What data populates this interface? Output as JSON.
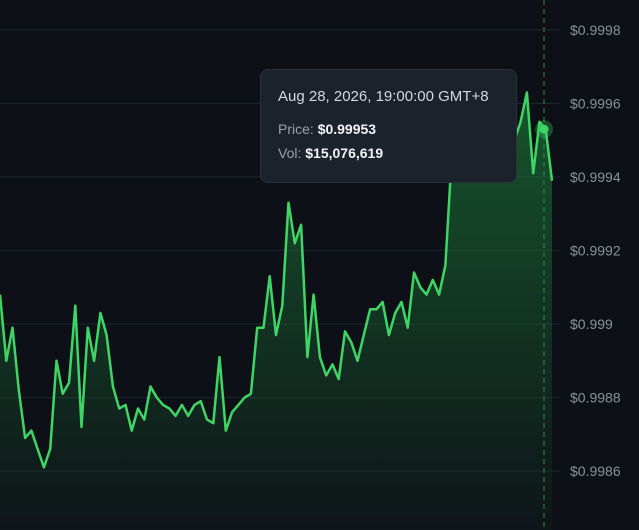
{
  "chart_data": {
    "type": "area",
    "y_axis_position": "right",
    "grid": true,
    "ylim": [
      0.99845,
      0.99982
    ],
    "yticks": [
      {
        "value": 0.9998,
        "label": "$0.9998"
      },
      {
        "value": 0.9996,
        "label": "$0.9996"
      },
      {
        "value": 0.9994,
        "label": "$0.9994"
      },
      {
        "value": 0.9992,
        "label": "$0.9992"
      },
      {
        "value": 0.999,
        "label": "$0.999"
      },
      {
        "value": 0.9988,
        "label": "$0.9988"
      },
      {
        "value": 0.9986,
        "label": "$0.9986"
      }
    ],
    "series": [
      {
        "values": [
          0.99908,
          0.9989,
          0.99899,
          0.99882,
          0.99869,
          0.99871,
          0.99866,
          0.99861,
          0.99866,
          0.9989,
          0.99881,
          0.99884,
          0.99905,
          0.99872,
          0.99899,
          0.9989,
          0.99903,
          0.99897,
          0.99883,
          0.99877,
          0.99878,
          0.99871,
          0.99877,
          0.99874,
          0.99883,
          0.9988,
          0.99878,
          0.99877,
          0.99875,
          0.99878,
          0.99875,
          0.99878,
          0.99879,
          0.99874,
          0.99873,
          0.99891,
          0.99871,
          0.99876,
          0.99878,
          0.9988,
          0.99881,
          0.99899,
          0.99899,
          0.99913,
          0.99897,
          0.99905,
          0.99933,
          0.99922,
          0.99927,
          0.99891,
          0.99908,
          0.99891,
          0.99886,
          0.99889,
          0.99885,
          0.99898,
          0.99895,
          0.9989,
          0.99897,
          0.99904,
          0.99904,
          0.99906,
          0.99897,
          0.99903,
          0.99906,
          0.99899,
          0.99914,
          0.9991,
          0.99908,
          0.99912,
          0.99908,
          0.99916,
          0.99945,
          0.9995,
          0.99952,
          0.99955,
          0.99958,
          0.9996,
          0.99955,
          0.99962,
          0.99958,
          0.99955,
          0.9995,
          0.99955,
          0.99963,
          0.99941,
          0.99955,
          0.99953,
          0.99939
        ]
      }
    ],
    "hover": {
      "point_index": 87,
      "date": "Aug 28, 2026, 19:00:00 GMT+8",
      "price_label": "Price:",
      "price_value": "$0.99953",
      "vol_label": "Vol:",
      "vol_value": "$15,076,619"
    },
    "colors": {
      "line": "#3fd565",
      "fill": "#1f8c3f",
      "grid": "#1e242c",
      "crosshair": "#2f8a4a",
      "background": "#0d1117"
    }
  }
}
